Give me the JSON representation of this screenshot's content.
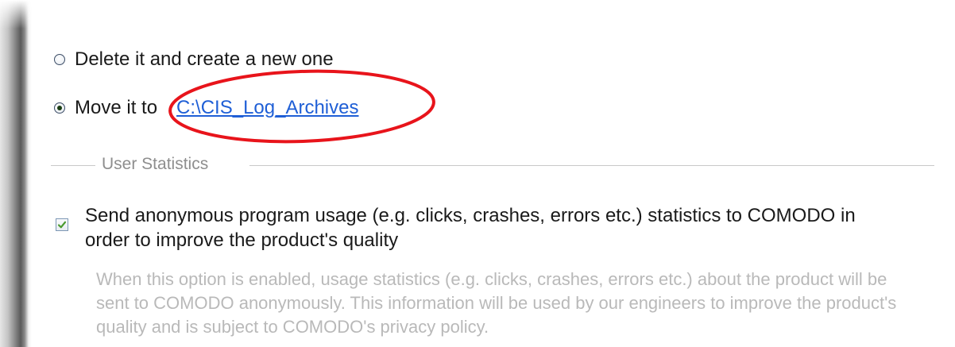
{
  "cleanup_options": {
    "delete_option": {
      "label": "Delete it and create a new one",
      "selected": false
    },
    "move_option": {
      "label": "Move it to",
      "selected": true,
      "path_link": "C:\\CIS_Log_Archives"
    }
  },
  "user_statistics": {
    "group_title": "User Statistics",
    "send_stats": {
      "label": "Send anonymous program usage (e.g. clicks, crashes, errors etc.) statistics to COMODO in order to improve the product's quality",
      "checked": true
    },
    "description": "When this option is enabled, usage statistics (e.g. clicks, crashes, errors etc.) about the product will be sent to COMODO anonymously. This information will be used by our engineers to improve the product's quality and is subject to COMODO's privacy policy."
  },
  "colors": {
    "link": "#1f5fd6",
    "highlight_oval": "#e8141b",
    "checkmark": "#4a9a2e",
    "disabled_text": "#b9b9b9"
  }
}
